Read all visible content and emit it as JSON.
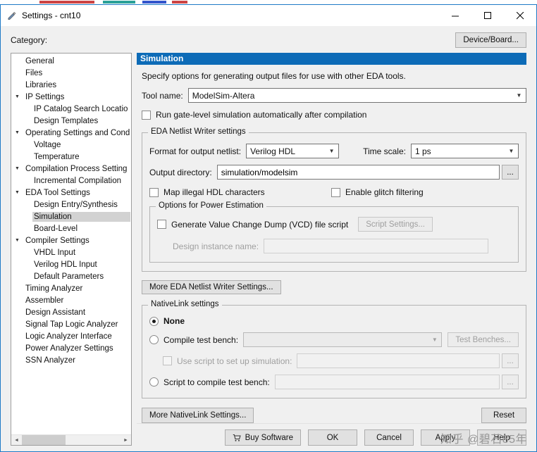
{
  "window": {
    "title": "Settings - cnt10"
  },
  "topbar": {
    "category_label": "Category:",
    "device_board_button": "Device/Board..."
  },
  "sidebar": {
    "items": [
      {
        "label": "General",
        "level": 1,
        "arrow": false,
        "selected": false
      },
      {
        "label": "Files",
        "level": 1,
        "arrow": false,
        "selected": false
      },
      {
        "label": "Libraries",
        "level": 1,
        "arrow": false,
        "selected": false
      },
      {
        "label": "IP Settings",
        "level": 0,
        "arrow": true,
        "selected": false
      },
      {
        "label": "IP Catalog Search Locatio",
        "level": 2,
        "arrow": false,
        "selected": false
      },
      {
        "label": "Design Templates",
        "level": 2,
        "arrow": false,
        "selected": false
      },
      {
        "label": "Operating Settings and Cond",
        "level": 0,
        "arrow": true,
        "selected": false
      },
      {
        "label": "Voltage",
        "level": 2,
        "arrow": false,
        "selected": false
      },
      {
        "label": "Temperature",
        "level": 2,
        "arrow": false,
        "selected": false
      },
      {
        "label": "Compilation Process Setting",
        "level": 0,
        "arrow": true,
        "selected": false
      },
      {
        "label": "Incremental Compilation",
        "level": 2,
        "arrow": false,
        "selected": false
      },
      {
        "label": "EDA Tool Settings",
        "level": 0,
        "arrow": true,
        "selected": false
      },
      {
        "label": "Design Entry/Synthesis",
        "level": 2,
        "arrow": false,
        "selected": false
      },
      {
        "label": "Simulation",
        "level": 2,
        "arrow": false,
        "selected": true
      },
      {
        "label": "Board-Level",
        "level": 2,
        "arrow": false,
        "selected": false
      },
      {
        "label": "Compiler Settings",
        "level": 0,
        "arrow": true,
        "selected": false
      },
      {
        "label": "VHDL Input",
        "level": 2,
        "arrow": false,
        "selected": false
      },
      {
        "label": "Verilog HDL Input",
        "level": 2,
        "arrow": false,
        "selected": false
      },
      {
        "label": "Default Parameters",
        "level": 2,
        "arrow": false,
        "selected": false
      },
      {
        "label": "Timing Analyzer",
        "level": 1,
        "arrow": false,
        "selected": false
      },
      {
        "label": "Assembler",
        "level": 1,
        "arrow": false,
        "selected": false
      },
      {
        "label": "Design Assistant",
        "level": 1,
        "arrow": false,
        "selected": false
      },
      {
        "label": "Signal Tap Logic Analyzer",
        "level": 1,
        "arrow": false,
        "selected": false
      },
      {
        "label": "Logic Analyzer Interface",
        "level": 1,
        "arrow": false,
        "selected": false
      },
      {
        "label": "Power Analyzer Settings",
        "level": 1,
        "arrow": false,
        "selected": false
      },
      {
        "label": "SSN Analyzer",
        "level": 1,
        "arrow": false,
        "selected": false
      }
    ]
  },
  "main": {
    "header": "Simulation",
    "description": "Specify options for generating output files for use with other EDA tools.",
    "tool_name": {
      "label": "Tool name:",
      "value": "ModelSim-Altera"
    },
    "run_gate_label": "Run gate-level simulation automatically after compilation",
    "eda": {
      "title": "EDA Netlist Writer settings",
      "format_label": "Format for output netlist:",
      "format_value": "Verilog HDL",
      "time_scale_label": "Time scale:",
      "time_scale_value": "1 ps",
      "output_dir_label": "Output directory:",
      "output_dir_value": "simulation/modelsim",
      "browse_label": "...",
      "map_illegal_label": "Map illegal HDL characters",
      "glitch_label": "Enable glitch filtering",
      "power": {
        "title": "Options for Power Estimation",
        "vcd_label": "Generate Value Change Dump (VCD) file script",
        "script_settings_button": "Script Settings...",
        "design_instance_label": "Design instance name:"
      }
    },
    "more_eda_button": "More EDA Netlist Writer Settings...",
    "nativelink": {
      "title": "NativeLink settings",
      "none_label": "None",
      "compile_label": "Compile test bench:",
      "test_benches_button": "Test Benches...",
      "use_script_label": "Use script to set up simulation:",
      "script_compile_label": "Script to compile test bench:",
      "browse_label": "..."
    },
    "more_nativelink_button": "More NativeLink Settings...",
    "reset_button": "Reset"
  },
  "footer": {
    "buy_software": "Buy Software",
    "ok": "OK",
    "cancel": "Cancel",
    "apply": "Apply",
    "help": "Help"
  },
  "watermark": {
    "text": "知乎 @碧石85年"
  }
}
